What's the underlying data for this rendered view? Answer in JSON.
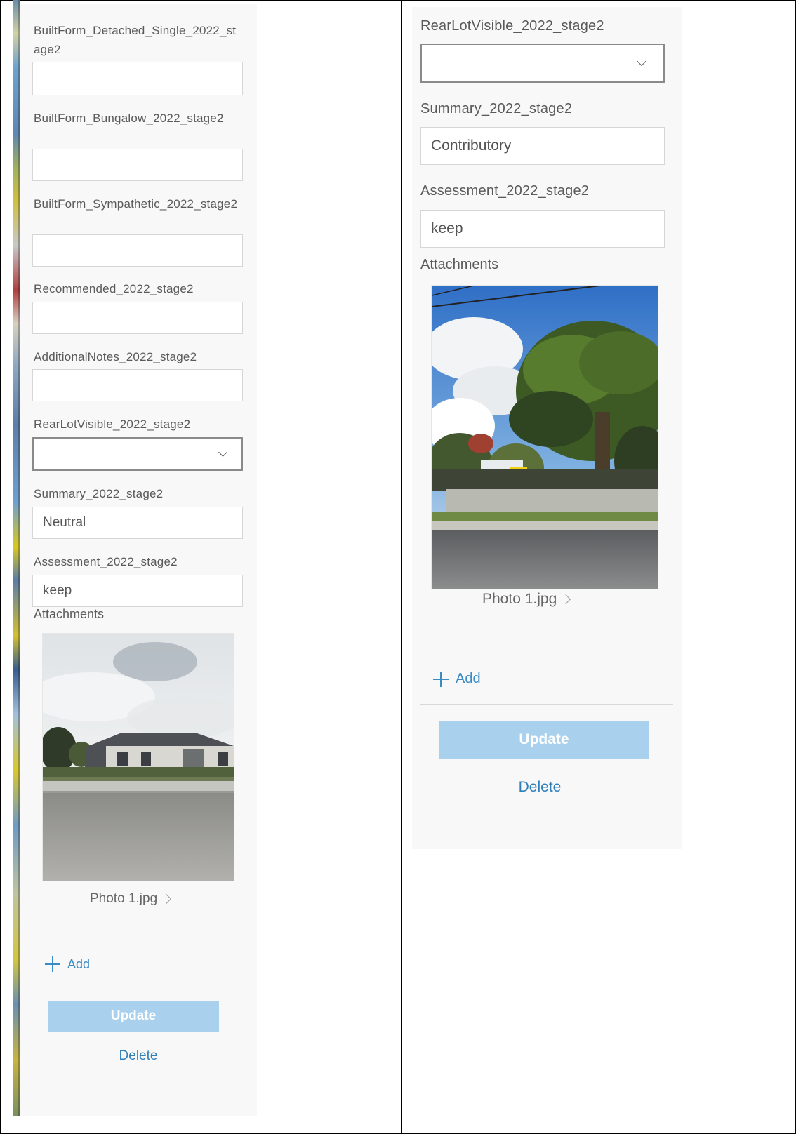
{
  "left_panel": {
    "fields": [
      {
        "label": "BuiltForm_Detached_Single_2022_stage2",
        "value": ""
      },
      {
        "label": "BuiltForm_Bungalow_2022_stage2",
        "value": ""
      },
      {
        "label": "BuiltForm_Sympathetic_2022_stage2",
        "value": ""
      },
      {
        "label": "Recommended_2022_stage2",
        "value": ""
      },
      {
        "label": "AdditionalNotes_2022_stage2",
        "value": ""
      }
    ],
    "rear_lot": {
      "label": "RearLotVisible_2022_stage2",
      "value": ""
    },
    "summary": {
      "label": "Summary_2022_stage2",
      "value": "Neutral"
    },
    "assessment": {
      "label": "Assessment_2022_stage2",
      "value": "keep"
    },
    "attachments_label": "Attachments",
    "photo_name": "Photo 1.jpg",
    "add_label": "Add",
    "update_label": "Update",
    "delete_label": "Delete"
  },
  "right_panel": {
    "rear_lot": {
      "label": "RearLotVisible_2022_stage2",
      "value": ""
    },
    "summary": {
      "label": "Summary_2022_stage2",
      "value": "Contributory"
    },
    "assessment": {
      "label": "Assessment_2022_stage2",
      "value": "keep"
    },
    "attachments_label": "Attachments",
    "photo_name": "Photo 1.jpg",
    "add_label": "Add",
    "update_label": "Update",
    "delete_label": "Delete"
  },
  "colors": {
    "accent": "#3a8ac4",
    "update_disabled": "#a9d1ee",
    "panel_bg": "#f8f8f8"
  }
}
